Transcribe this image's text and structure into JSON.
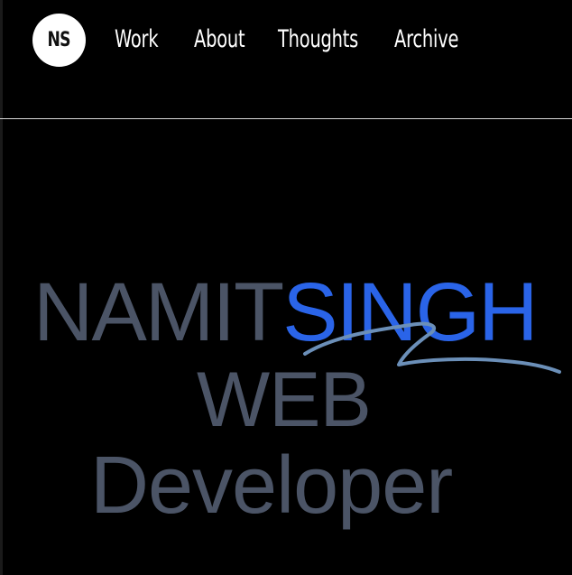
{
  "logo": {
    "initials": "NS"
  },
  "nav": {
    "items": [
      {
        "label": "Work"
      },
      {
        "label": "About"
      },
      {
        "label": "Thoughts"
      },
      {
        "label": "Archive"
      }
    ]
  },
  "hero": {
    "first_name": "NAMIT",
    "last_name": "SINGH",
    "role_line1": "WEB",
    "role_line2": "Developer"
  },
  "colors": {
    "background": "#000000",
    "accent_blue": "#2a64e8",
    "slate_text": "#4b5466",
    "swoosh": "#6b8fb8"
  }
}
